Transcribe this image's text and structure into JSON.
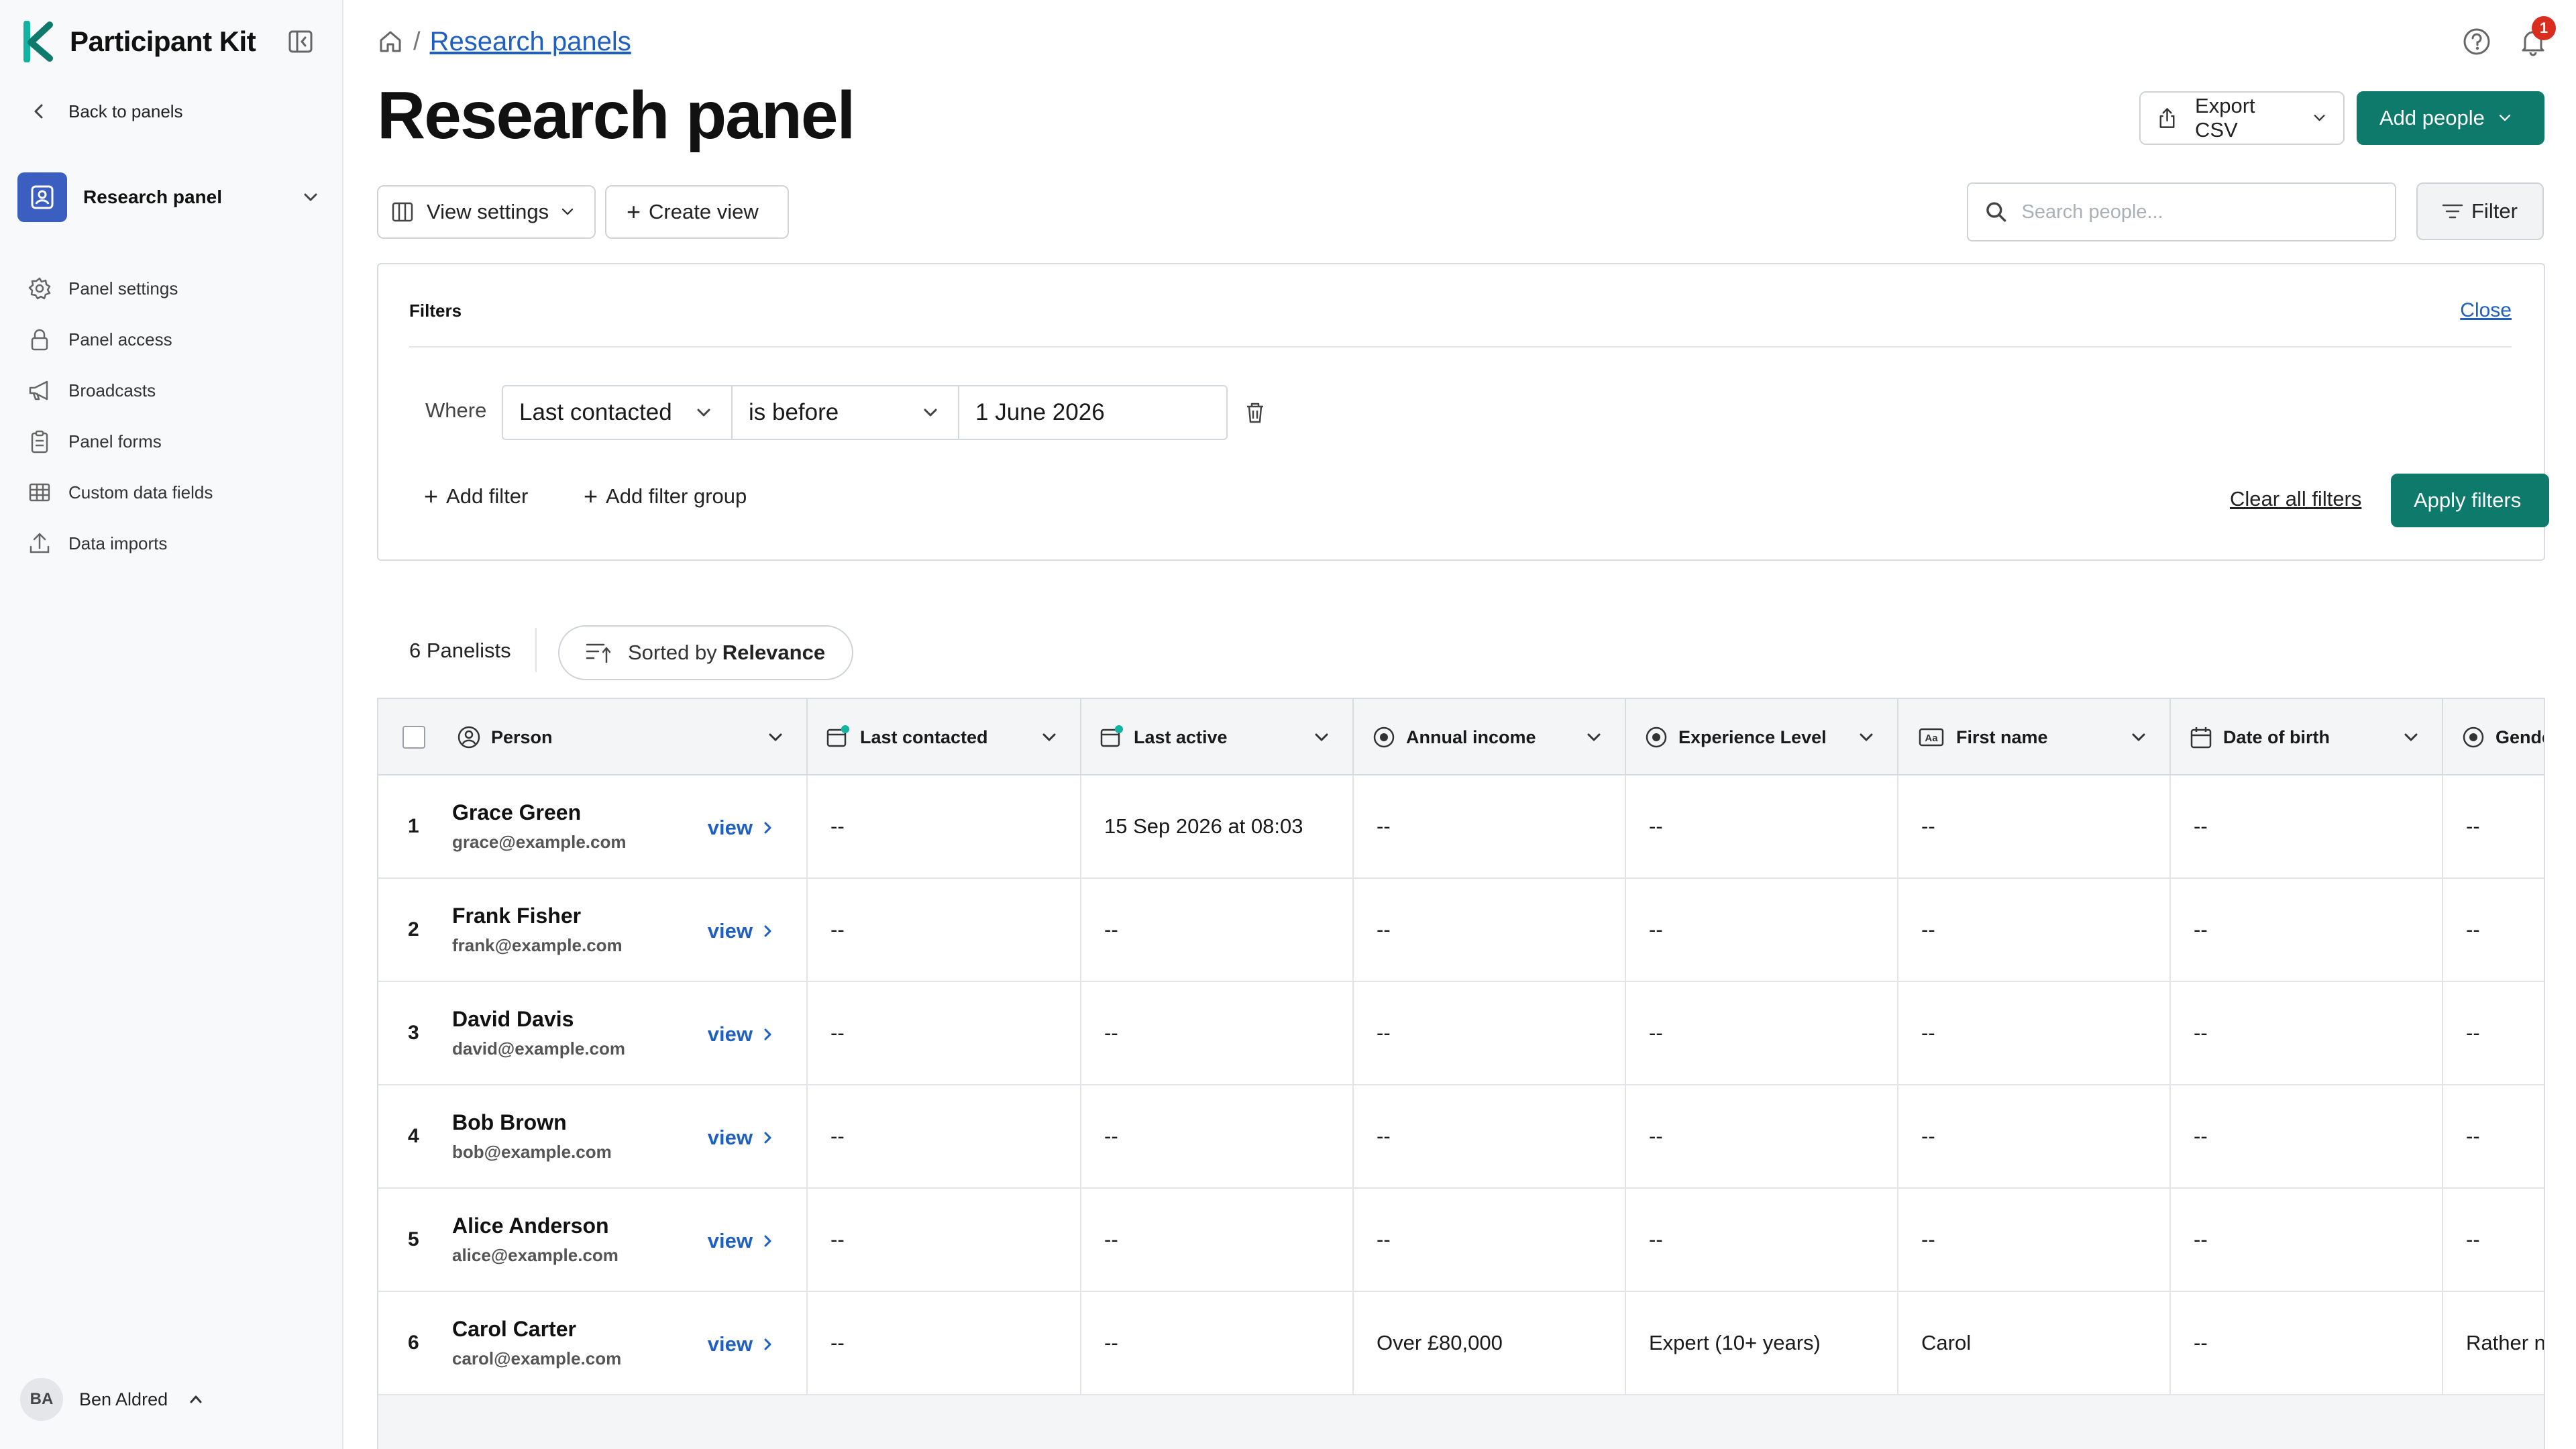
{
  "app": {
    "name": "Participant Kit",
    "brand_color": "#12b3a0",
    "primary_color": "#0e7a6c",
    "link_color": "#1f5fbf"
  },
  "sidebar": {
    "back_label": "Back to panels",
    "panel_switcher": {
      "label": "Research panel"
    },
    "items": [
      {
        "label": "Panel settings",
        "icon": "gear-icon"
      },
      {
        "label": "Panel access",
        "icon": "lock-icon"
      },
      {
        "label": "Broadcasts",
        "icon": "megaphone-icon"
      },
      {
        "label": "Panel forms",
        "icon": "clipboard-icon"
      },
      {
        "label": "Custom data fields",
        "icon": "table-icon"
      },
      {
        "label": "Data imports",
        "icon": "upload-icon"
      }
    ],
    "user": {
      "initials": "BA",
      "name": "Ben Aldred"
    }
  },
  "header": {
    "breadcrumb": "Research panels",
    "notification_count": "1",
    "title": "Research panel",
    "export_label": "Export CSV",
    "add_people_label": "Add people"
  },
  "toolbar": {
    "view_settings_label": "View settings",
    "create_view_label": "Create view",
    "search_placeholder": "Search people...",
    "filter_label": "Filter"
  },
  "filters": {
    "heading": "Filters",
    "close_label": "Close",
    "where_label": "Where",
    "column": "Last contacted",
    "operator": "is before",
    "value": "1 June 2026",
    "add_filter_label": "Add filter",
    "add_group_label": "Add filter group",
    "clear_all_label": "Clear all filters",
    "apply_label": "Apply filters"
  },
  "summary": {
    "count_label": "6 Panelists",
    "sort_prefix": "Sorted by",
    "sort_value": "Relevance"
  },
  "table": {
    "columns": [
      {
        "label": "Person",
        "icon": "person-circle-icon"
      },
      {
        "label": "Last contacted",
        "icon": "calendar-sparkle-icon"
      },
      {
        "label": "Last active",
        "icon": "calendar-sparkle-icon"
      },
      {
        "label": "Annual income",
        "icon": "radio-icon"
      },
      {
        "label": "Experience Level",
        "icon": "radio-icon"
      },
      {
        "label": "First name",
        "icon": "text-aa-icon"
      },
      {
        "label": "Date of birth",
        "icon": "calendar-icon"
      },
      {
        "label": "Gende",
        "icon": "radio-icon"
      }
    ],
    "view_label": "view",
    "rows": [
      {
        "num": "1",
        "name": "Grace Green",
        "email": "grace@example.com",
        "last_contacted": "--",
        "last_active": "15 Sep 2026 at 08:03",
        "income": "--",
        "experience": "--",
        "first_name": "--",
        "dob": "--",
        "gender": "--"
      },
      {
        "num": "2",
        "name": "Frank Fisher",
        "email": "frank@example.com",
        "last_contacted": "--",
        "last_active": "--",
        "income": "--",
        "experience": "--",
        "first_name": "--",
        "dob": "--",
        "gender": "--"
      },
      {
        "num": "3",
        "name": "David Davis",
        "email": "david@example.com",
        "last_contacted": "--",
        "last_active": "--",
        "income": "--",
        "experience": "--",
        "first_name": "--",
        "dob": "--",
        "gender": "--"
      },
      {
        "num": "4",
        "name": "Bob Brown",
        "email": "bob@example.com",
        "last_contacted": "--",
        "last_active": "--",
        "income": "--",
        "experience": "--",
        "first_name": "--",
        "dob": "--",
        "gender": "--"
      },
      {
        "num": "5",
        "name": "Alice Anderson",
        "email": "alice@example.com",
        "last_contacted": "--",
        "last_active": "--",
        "income": "--",
        "experience": "--",
        "first_name": "--",
        "dob": "--",
        "gender": "--"
      },
      {
        "num": "6",
        "name": "Carol Carter",
        "email": "carol@example.com",
        "last_contacted": "--",
        "last_active": "--",
        "income": "Over £80,000",
        "experience": "Expert (10+ years)",
        "first_name": "Carol",
        "dob": "--",
        "gender": "Rather n"
      }
    ]
  }
}
